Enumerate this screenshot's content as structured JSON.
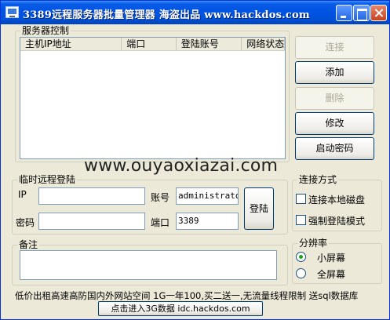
{
  "window": {
    "title": "3389远程服务器批量管理器   海盗出品 www.hackdos.com"
  },
  "server_group": {
    "legend": "服务器控制",
    "columns": [
      "主机IP地址",
      "端口",
      "登陆账号",
      "网络状态"
    ],
    "rows": []
  },
  "actions": {
    "connect_label": "连接",
    "add_label": "添加",
    "delete_label": "删除",
    "modify_label": "修改",
    "start_password_label": "启动密码"
  },
  "watermark": "www.ouyaoxiazai.com",
  "temp_login": {
    "legend": "临时远程登陆",
    "ip_label": "IP",
    "ip_value": "",
    "account_label": "账号",
    "account_value": "administrator",
    "password_label": "密码",
    "password_value": "",
    "port_label": "端口",
    "port_value": "3389",
    "login_label": "登陆"
  },
  "connect_mode": {
    "legend": "连接方式",
    "local_disk_label": "连接本地磁盘",
    "local_disk_checked": false,
    "force_login_label": "强制登陆模式",
    "force_login_checked": false
  },
  "remark": {
    "legend": "备注",
    "value": ""
  },
  "resolution": {
    "legend": "分辨率",
    "small_label": "小屏幕",
    "full_label": "全屏幕",
    "selected": "小屏幕"
  },
  "footer": {
    "ad_text": "低价出租高速高防国内外网站空间 1G一年100,买二送一,无流量线程限制 送sql数据库",
    "link_label": "点击进入3G数据 idc.hackdos.com"
  }
}
